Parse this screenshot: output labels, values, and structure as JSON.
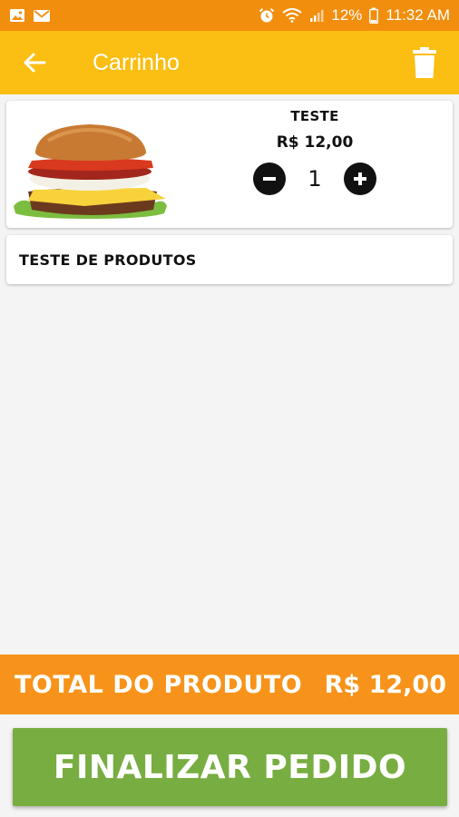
{
  "status_bar": {
    "battery_percent": "12%",
    "time": "11:32 AM",
    "icons": [
      "gallery-icon",
      "mail-icon",
      "alarm-icon",
      "wifi-icon",
      "signal-icon",
      "battery-icon"
    ]
  },
  "app_bar": {
    "title": "Carrinho",
    "back_icon": "arrow-back-icon",
    "delete_icon": "trash-icon"
  },
  "cart": {
    "item": {
      "name": "TESTE",
      "price": "R$ 12,00",
      "quantity": "1",
      "image": "burger-image"
    },
    "description": "TESTE DE PRODUTOS"
  },
  "summary": {
    "total_label": "TOTAL DO PRODUTO",
    "total_value": "R$ 12,00"
  },
  "actions": {
    "finalize_label": "FINALIZAR PEDIDO"
  },
  "colors": {
    "status_bar": "#f28e0d",
    "app_bar": "#fbbe12",
    "total_bar": "#f7931a",
    "finalize_button": "#78ad41"
  }
}
